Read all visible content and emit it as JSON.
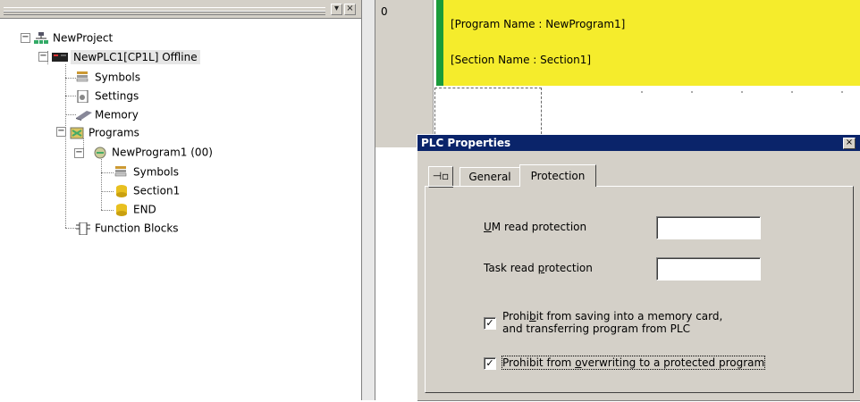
{
  "tree": {
    "nodes": [
      {
        "label": "NewProject",
        "icon": "network-icon"
      },
      {
        "label": "NewPLC1[CP1L] Offline",
        "icon": "plc-icon"
      },
      {
        "label": "Symbols",
        "icon": "symbols-icon"
      },
      {
        "label": "Settings",
        "icon": "settings-icon"
      },
      {
        "label": "Memory",
        "icon": "memory-icon"
      },
      {
        "label": "Programs",
        "icon": "programs-icon"
      },
      {
        "label": "NewProgram1 (00)",
        "icon": "program-icon"
      },
      {
        "label": "Symbols",
        "icon": "symbols-icon"
      },
      {
        "label": "Section1",
        "icon": "section-icon"
      },
      {
        "label": "END",
        "icon": "section-icon"
      },
      {
        "label": "Function Blocks",
        "icon": "function-blocks-icon"
      }
    ]
  },
  "ladder": {
    "rung_number": "0",
    "program_name": "[Program Name : NewProgram1]",
    "section_name": "[Section Name : Section1]"
  },
  "dialog": {
    "title": "PLC Properties",
    "tabs": [
      "General",
      "Protection"
    ],
    "active_tab": "Protection",
    "um_read_label_pre": "U",
    "um_read_label_post": "M read protection",
    "task_read_label_pre": "Task read ",
    "task_read_label_u": "p",
    "task_read_label_post": "rotection",
    "um_read_value": "",
    "task_read_value": "",
    "prohibit_save_pre": "Prohi",
    "prohibit_save_u": "b",
    "prohibit_save_post": "it from saving into a memory card,",
    "prohibit_save_line2": "and transferring program from PLC",
    "prohibit_save_checked": true,
    "prohibit_overwrite_pre": "Prohibit from ",
    "prohibit_overwrite_u": "o",
    "prohibit_overwrite_post": "verwriting to a protected program",
    "prohibit_overwrite_checked": true
  },
  "colors": {
    "title_bar": "#0a246a",
    "section_header": "#f5ec2c",
    "rung_marker": "#1a9b3a"
  }
}
